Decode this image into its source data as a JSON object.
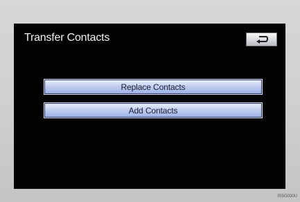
{
  "screen": {
    "title": "Transfer Contacts",
    "back_icon": "back-arrow-icon"
  },
  "actions": {
    "replace_label": "Replace Contacts",
    "add_label": "Add Contacts"
  },
  "footer": {
    "code": "ISSG030U"
  },
  "colors": {
    "screen_bg": "#030303",
    "frame_bg": "#cfcfcf",
    "title_text": "#f2f2f2",
    "button_fill": "#c6d2f2",
    "button_text": "#1a1d2a"
  }
}
